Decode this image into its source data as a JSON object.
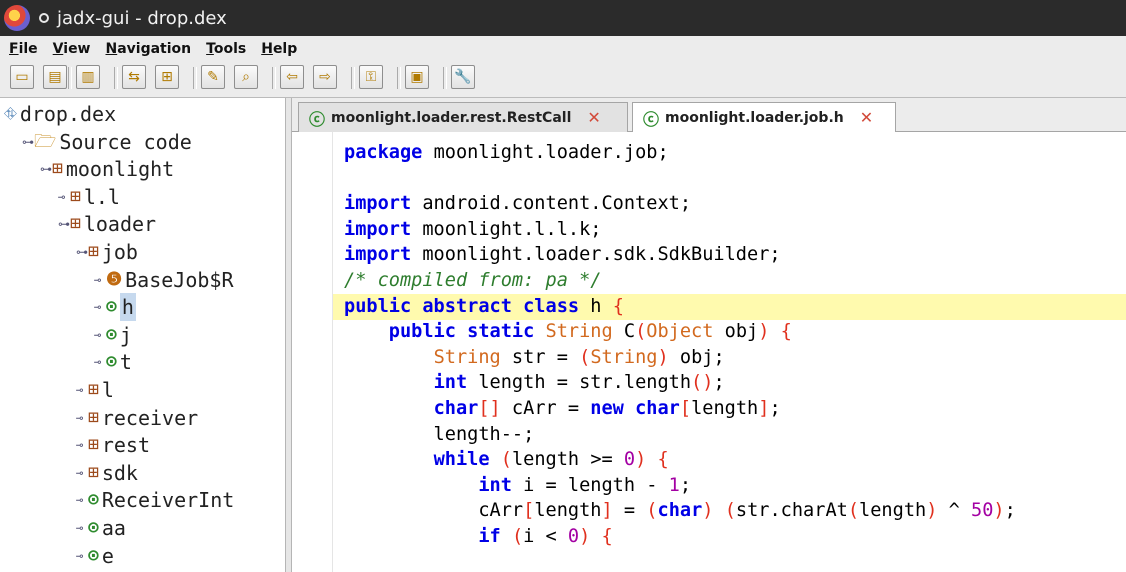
{
  "window": {
    "title": "jadx-gui - drop.dex"
  },
  "menu": [
    "File",
    "View",
    "Navigation",
    "Tools",
    "Help"
  ],
  "toolbar": {
    "buttons": [
      {
        "name": "open-file-icon",
        "glyph": "▭"
      },
      {
        "name": "save-all-icon",
        "glyph": "▤"
      },
      {
        "name": "export-icon",
        "glyph": "▥"
      },
      {
        "name": "sync-tree-icon",
        "glyph": "⇆"
      },
      {
        "name": "flat-packages-icon",
        "glyph": "⊞"
      },
      {
        "name": "search-text-icon",
        "glyph": "✎"
      },
      {
        "name": "find-class-icon",
        "glyph": "⌕"
      },
      {
        "name": "back-icon",
        "glyph": "⇦"
      },
      {
        "name": "forward-icon",
        "glyph": "⇨"
      },
      {
        "name": "deobfuscation-icon",
        "glyph": "⚿"
      },
      {
        "name": "log-viewer-icon",
        "glyph": "▣"
      },
      {
        "name": "preferences-icon",
        "glyph": "🔧"
      }
    ]
  },
  "tree": {
    "nodes": [
      {
        "label": "drop.dex",
        "icon": "dex",
        "indent": 0,
        "toggle": ""
      },
      {
        "label": "Source code",
        "icon": "src",
        "indent": 1,
        "toggle": "expanded"
      },
      {
        "label": "moonlight",
        "icon": "pkg",
        "indent": 2,
        "toggle": "expanded"
      },
      {
        "label": "l.l",
        "icon": "pkg",
        "indent": 3,
        "toggle": "collapsed"
      },
      {
        "label": "loader",
        "icon": "pkg",
        "indent": 3,
        "toggle": "expanded"
      },
      {
        "label": "job",
        "icon": "pkg",
        "indent": 4,
        "toggle": "expanded"
      },
      {
        "label": "BaseJob$R",
        "icon": "enum",
        "indent": 5,
        "toggle": "collapsed"
      },
      {
        "label": "h",
        "icon": "cls",
        "indent": 5,
        "toggle": "collapsed",
        "selected": true
      },
      {
        "label": "j",
        "icon": "cls",
        "indent": 5,
        "toggle": "collapsed"
      },
      {
        "label": "t",
        "icon": "cls-abs",
        "indent": 5,
        "toggle": "collapsed"
      },
      {
        "label": "l",
        "icon": "pkg",
        "indent": 4,
        "toggle": "collapsed"
      },
      {
        "label": "receiver",
        "icon": "pkg",
        "indent": 4,
        "toggle": "collapsed"
      },
      {
        "label": "rest",
        "icon": "pkg",
        "indent": 4,
        "toggle": "collapsed"
      },
      {
        "label": "sdk",
        "icon": "pkg",
        "indent": 4,
        "toggle": "collapsed"
      },
      {
        "label": "ReceiverInt",
        "icon": "cls-abs",
        "indent": 4,
        "toggle": "collapsed"
      },
      {
        "label": "aa",
        "icon": "cls-abs",
        "indent": 4,
        "toggle": "collapsed"
      },
      {
        "label": "e",
        "icon": "cls",
        "indent": 4,
        "toggle": "collapsed"
      }
    ]
  },
  "tabs": [
    {
      "label": "moonlight.loader.rest.RestCall",
      "active": false
    },
    {
      "label": "moonlight.loader.job.h",
      "active": true
    }
  ],
  "code": {
    "highlight_line": 6,
    "lines": [
      [
        [
          "kw",
          "package"
        ],
        [
          "pl",
          " moonlight.loader.job;"
        ]
      ],
      [],
      [
        [
          "kw",
          "import"
        ],
        [
          "pl",
          " android.content.Context;"
        ]
      ],
      [
        [
          "kw",
          "import"
        ],
        [
          "pl",
          " moonlight.l.l.k;"
        ]
      ],
      [
        [
          "kw",
          "import"
        ],
        [
          "pl",
          " moonlight.loader.sdk.SdkBuilder;"
        ]
      ],
      [
        [
          "cm",
          "/* compiled from: pa */"
        ]
      ],
      [
        [
          "kw",
          "public abstract class"
        ],
        [
          "pl",
          " h "
        ],
        [
          "br",
          "{"
        ]
      ],
      [
        [
          "pl",
          "    "
        ],
        [
          "kw",
          "public static"
        ],
        [
          "pl",
          " "
        ],
        [
          "ty",
          "String"
        ],
        [
          "pl",
          " C"
        ],
        [
          "br",
          "("
        ],
        [
          "ty",
          "Object"
        ],
        [
          "pl",
          " obj"
        ],
        [
          "br",
          ")"
        ],
        [
          "pl",
          " "
        ],
        [
          "br",
          "{"
        ]
      ],
      [
        [
          "pl",
          "        "
        ],
        [
          "ty",
          "String"
        ],
        [
          "pl",
          " str = "
        ],
        [
          "br",
          "("
        ],
        [
          "ty",
          "String"
        ],
        [
          "br",
          ")"
        ],
        [
          "pl",
          " obj;"
        ]
      ],
      [
        [
          "pl",
          "        "
        ],
        [
          "kw",
          "int"
        ],
        [
          "pl",
          " length = str.length"
        ],
        [
          "br",
          "()"
        ],
        [
          "pl",
          ";"
        ]
      ],
      [
        [
          "pl",
          "        "
        ],
        [
          "kw",
          "char"
        ],
        [
          "br",
          "[]"
        ],
        [
          "pl",
          " cArr = "
        ],
        [
          "kw",
          "new char"
        ],
        [
          "br",
          "["
        ],
        [
          "pl",
          "length"
        ],
        [
          "br",
          "]"
        ],
        [
          "pl",
          ";"
        ]
      ],
      [
        [
          "pl",
          "        length--;"
        ]
      ],
      [
        [
          "pl",
          "        "
        ],
        [
          "kw",
          "while"
        ],
        [
          "pl",
          " "
        ],
        [
          "br",
          "("
        ],
        [
          "pl",
          "length >= "
        ],
        [
          "nm",
          "0"
        ],
        [
          "br",
          ")"
        ],
        [
          "pl",
          " "
        ],
        [
          "br",
          "{"
        ]
      ],
      [
        [
          "pl",
          "            "
        ],
        [
          "kw",
          "int"
        ],
        [
          "pl",
          " i = length - "
        ],
        [
          "nm",
          "1"
        ],
        [
          "pl",
          ";"
        ]
      ],
      [
        [
          "pl",
          "            cArr"
        ],
        [
          "br",
          "["
        ],
        [
          "pl",
          "length"
        ],
        [
          "br",
          "]"
        ],
        [
          "pl",
          " = "
        ],
        [
          "br",
          "("
        ],
        [
          "kw",
          "char"
        ],
        [
          "br",
          ")"
        ],
        [
          "pl",
          " "
        ],
        [
          "br",
          "("
        ],
        [
          "pl",
          "str.charAt"
        ],
        [
          "br",
          "("
        ],
        [
          "pl",
          "length"
        ],
        [
          "br",
          ")"
        ],
        [
          "pl",
          " ^ "
        ],
        [
          "nm",
          "50"
        ],
        [
          "br",
          ")"
        ],
        [
          "pl",
          ";"
        ]
      ],
      [
        [
          "pl",
          "            "
        ],
        [
          "kw",
          "if"
        ],
        [
          "pl",
          " "
        ],
        [
          "br",
          "("
        ],
        [
          "pl",
          "i < "
        ],
        [
          "nm",
          "0"
        ],
        [
          "br",
          ")"
        ],
        [
          "pl",
          " "
        ],
        [
          "br",
          "{"
        ]
      ]
    ]
  }
}
